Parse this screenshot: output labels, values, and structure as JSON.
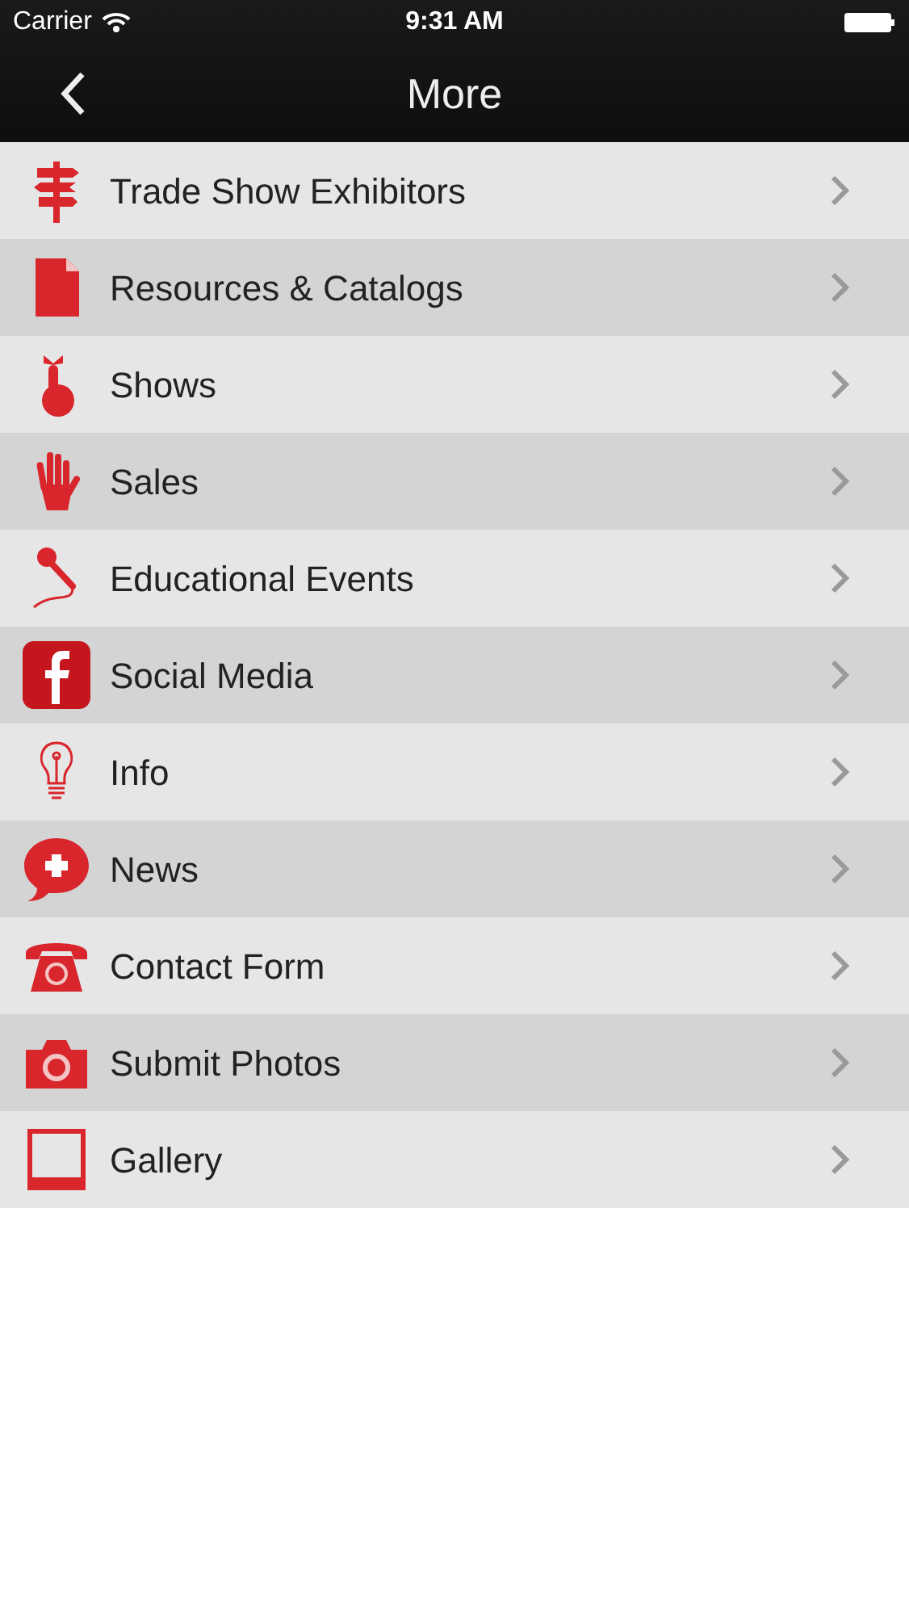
{
  "status_bar": {
    "carrier": "Carrier",
    "time": "9:31 AM"
  },
  "nav_bar": {
    "title": "More"
  },
  "menu_items": [
    {
      "label": "Trade Show Exhibitors"
    },
    {
      "label": "Resources & Catalogs"
    },
    {
      "label": "Shows"
    },
    {
      "label": "Sales"
    },
    {
      "label": "Educational Events"
    },
    {
      "label": "Social Media"
    },
    {
      "label": "Info"
    },
    {
      "label": "News"
    },
    {
      "label": "Contact Form"
    },
    {
      "label": "Submit Photos"
    },
    {
      "label": "Gallery"
    }
  ]
}
